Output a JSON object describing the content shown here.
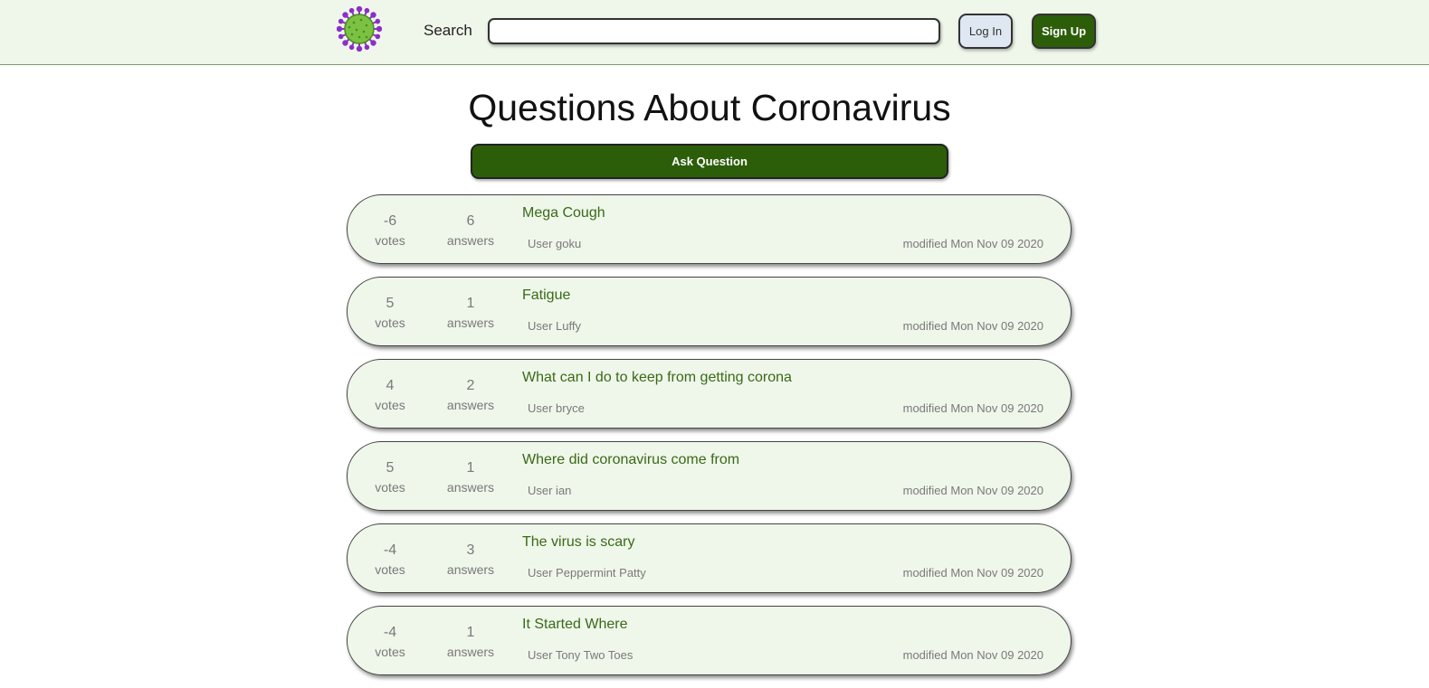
{
  "header": {
    "search_label": "Search",
    "search_placeholder": "",
    "login_label": "Log In",
    "signup_label": "Sign Up"
  },
  "page": {
    "title": "Questions About Coronavirus",
    "ask_label": "Ask Question"
  },
  "questions": [
    {
      "votes": "-6",
      "votes_label": "votes",
      "answers": "6",
      "answers_label": "answers",
      "title": "Mega Cough",
      "user": "User goku",
      "modified": "modified Mon Nov 09 2020"
    },
    {
      "votes": "5",
      "votes_label": "votes",
      "answers": "1",
      "answers_label": "answers",
      "title": "Fatigue",
      "user": "User Luffy",
      "modified": "modified Mon Nov 09 2020"
    },
    {
      "votes": "4",
      "votes_label": "votes",
      "answers": "2",
      "answers_label": "answers",
      "title": "What can I do to keep from getting corona",
      "user": "User bryce",
      "modified": "modified Mon Nov 09 2020"
    },
    {
      "votes": "5",
      "votes_label": "votes",
      "answers": "1",
      "answers_label": "answers",
      "title": "Where did coronavirus come from",
      "user": "User ian",
      "modified": "modified Mon Nov 09 2020"
    },
    {
      "votes": "-4",
      "votes_label": "votes",
      "answers": "3",
      "answers_label": "answers",
      "title": "The virus is scary",
      "user": "User Peppermint Patty",
      "modified": "modified Mon Nov 09 2020"
    },
    {
      "votes": "-4",
      "votes_label": "votes",
      "answers": "1",
      "answers_label": "answers",
      "title": "It Started Where",
      "user": "User Tony Two Toes",
      "modified": "modified Mon Nov 09 2020"
    }
  ],
  "colors": {
    "brand_green": "#2c5e0a",
    "nav_background": "#eff6ea",
    "title_green": "#3a6a18",
    "logo_body": "#7cc242",
    "logo_spikes": "#8b2fc9"
  },
  "icons": {
    "logo": "coronavirus-logo-icon"
  }
}
